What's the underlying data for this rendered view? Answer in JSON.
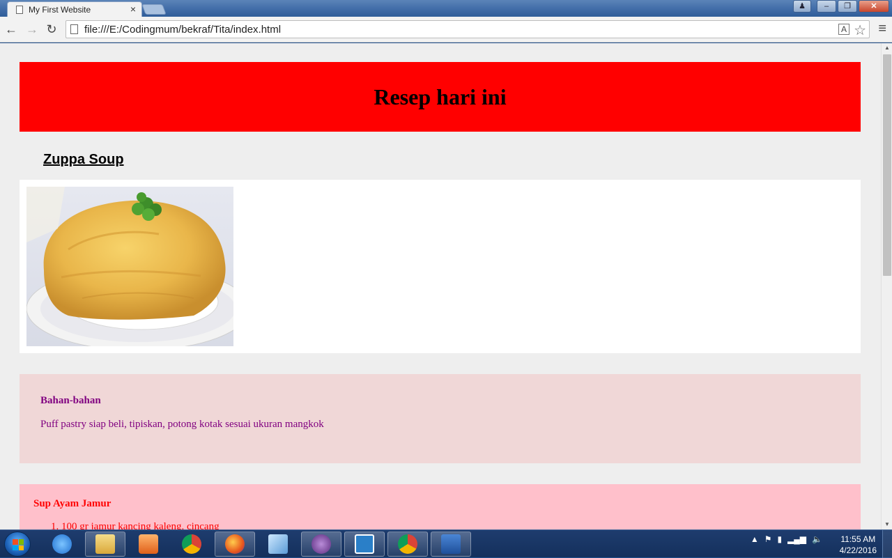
{
  "browser": {
    "tab_title": "My First Website",
    "tab_close": "×",
    "url": "file:///E:/Codingmum/bekraf/Tita/index.html",
    "back": "←",
    "forward": "→",
    "reload": "↻",
    "translate": "A",
    "star": "☆",
    "menu": "≡",
    "window_buttons": {
      "user": "♟",
      "minimize": "–",
      "maximize": "❐",
      "close": "✕"
    }
  },
  "page": {
    "header_title": "Resep hari ini",
    "recipe_title": "Zuppa Soup",
    "ingredients": {
      "heading": "Bahan-bahan",
      "text": "Puff pastry siap beli, tipiskan, potong kotak sesuai ukuran mangkok"
    },
    "sup_ayam": {
      "heading": "Sup Ayam Jamur",
      "items": [
        "100 gr jamur kancing kaleng, cincang"
      ]
    }
  },
  "taskbar": {
    "clock_time": "11:55 AM",
    "clock_date": "4/22/2016",
    "apps": [
      "internet-explorer",
      "file-explorer",
      "media-player",
      "chrome",
      "firefox",
      "notes",
      "cat-app",
      "bracket-app",
      "chrome-active",
      "word"
    ]
  },
  "colors": {
    "header_bg": "#ff0000",
    "ingredients_bg": "#f0d7d7",
    "ingredients_text": "#800080",
    "sup_bg": "#ffc0cb",
    "sup_text": "#ff0000"
  }
}
